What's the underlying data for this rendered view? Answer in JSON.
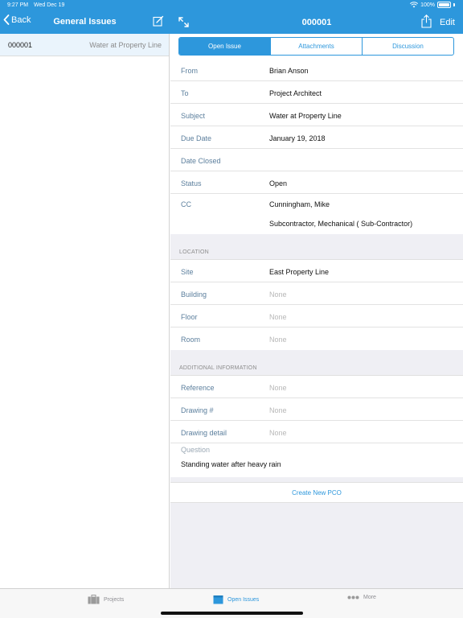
{
  "status_bar": {
    "time": "9:27 PM",
    "date": "Wed Dec 19",
    "battery": "100%"
  },
  "left_nav": {
    "back_label": "Back",
    "title": "General Issues"
  },
  "right_nav": {
    "title": "000001",
    "edit_label": "Edit"
  },
  "issue_list": [
    {
      "number": "000001",
      "subject": "Water at Property Line"
    }
  ],
  "segments": [
    {
      "label": "Open Issue",
      "active": true
    },
    {
      "label": "Attachments",
      "active": false
    },
    {
      "label": "Discussion",
      "active": false
    }
  ],
  "details": {
    "from": {
      "label": "From",
      "value": "Brian Anson"
    },
    "to": {
      "label": "To",
      "value": "Project Architect"
    },
    "subject": {
      "label": "Subject",
      "value": "Water at Property Line"
    },
    "due_date": {
      "label": "Due Date",
      "value": "January 19, 2018"
    },
    "date_closed": {
      "label": "Date Closed",
      "value": ""
    },
    "status": {
      "label": "Status",
      "value": "Open"
    },
    "cc": {
      "label": "CC",
      "values": [
        "Cunningham, Mike",
        "Subcontractor, Mechanical ( Sub-Contractor)"
      ]
    }
  },
  "location": {
    "header": "LOCATION",
    "site": {
      "label": "Site",
      "value": "East Property Line"
    },
    "building": {
      "label": "Building",
      "value": "None"
    },
    "floor": {
      "label": "Floor",
      "value": "None"
    },
    "room": {
      "label": "Room",
      "value": "None"
    }
  },
  "additional": {
    "header": "ADDITIONAL INFORMATION",
    "reference": {
      "label": "Reference",
      "value": "None"
    },
    "drawing_num": {
      "label": "Drawing #",
      "value": "None"
    },
    "drawing_detail": {
      "label": "Drawing detail",
      "value": "None"
    },
    "question": {
      "label": "Question",
      "value": "Standing water after heavy rain"
    }
  },
  "actions": {
    "create_pco": "Create New PCO"
  },
  "tabs": [
    {
      "label": "Projects",
      "icon": "briefcase-icon",
      "active": false
    },
    {
      "label": "Open Issues",
      "icon": "folder-icon",
      "active": true
    },
    {
      "label": "More",
      "icon": "more-dots-icon",
      "active": false
    }
  ],
  "colors": {
    "accent": "#2d97dc",
    "label": "#5c7f9d",
    "muted": "#b7b7b7"
  }
}
